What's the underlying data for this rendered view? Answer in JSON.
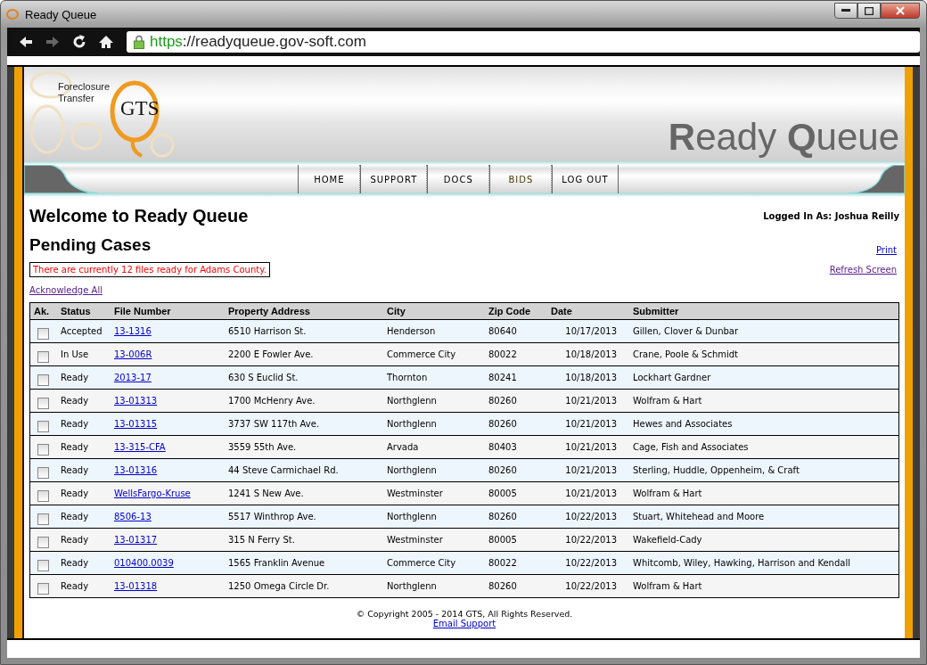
{
  "window": {
    "title": "Ready Queue"
  },
  "browser": {
    "url_scheme": "https",
    "url_rest": "://readyqueue.gov-soft.com"
  },
  "logo": {
    "line_1": "Foreclosure",
    "line_2": "Transfer",
    "mark": "GTS"
  },
  "site_title": "**R**eady **Q**ueue",
  "nav": [
    {
      "label": "HOME",
      "selected": false
    },
    {
      "label": "SUPPORT",
      "selected": false
    },
    {
      "label": "DOCS",
      "selected": false
    },
    {
      "label": "BIDS",
      "selected": true
    },
    {
      "label": "LOG OUT",
      "selected": false
    }
  ],
  "heading": "Welcome to Ready Queue",
  "logged_in": "Logged In As: Joshua Reilly",
  "subheading": "Pending Cases",
  "print_link": "Print",
  "notice": "There are currently 12 files ready for Adams County.",
  "refresh_link": "Refresh Screen",
  "acknowledge_link": "Acknowledge All",
  "table": {
    "columns": [
      "Ak.",
      "Status",
      "File Number",
      "Property Address",
      "City",
      "Zip Code",
      "Date",
      "Submitter"
    ],
    "rows": [
      {
        "checked": false,
        "status": "Accepted",
        "file": "13-1316",
        "address": "6510 Harrison St.",
        "city": "Henderson",
        "zip": "80640",
        "date": "10/17/2013",
        "submitter": "Gillen, Clover & Dunbar"
      },
      {
        "checked": false,
        "status": "In Use",
        "file": "13-006R",
        "address": "2200 E Fowler Ave.",
        "city": "Commerce City",
        "zip": "80022",
        "date": "10/18/2013",
        "submitter": "Crane, Poole & Schmidt"
      },
      {
        "checked": false,
        "status": "Ready",
        "file": "2013-17",
        "address": "630 S Euclid St.",
        "city": "Thornton",
        "zip": "80241",
        "date": "10/18/2013",
        "submitter": "Lockhart Gardner"
      },
      {
        "checked": false,
        "status": "Ready",
        "file": "13-01313",
        "address": "1700 McHenry Ave.",
        "city": "Northglenn",
        "zip": "80260",
        "date": "10/21/2013",
        "submitter": "Wolfram & Hart"
      },
      {
        "checked": false,
        "status": "Ready",
        "file": "13-01315",
        "address": "3737 SW 117th Ave.",
        "city": "Northglenn",
        "zip": "80260",
        "date": "10/21/2013",
        "submitter": "Hewes and Associates"
      },
      {
        "checked": false,
        "status": "Ready",
        "file": "13-315-CFA",
        "address": "3559 55th Ave.",
        "city": "Arvada",
        "zip": "80403",
        "date": "10/21/2013",
        "submitter": "Cage, Fish and Associates"
      },
      {
        "checked": false,
        "status": "Ready",
        "file": "13-01316",
        "address": "44 Steve Carmichael Rd.",
        "city": "Northglenn",
        "zip": "80260",
        "date": "10/21/2013",
        "submitter": "Sterling, Huddle, Oppenheim, & Craft"
      },
      {
        "checked": false,
        "status": "Ready",
        "file": "WellsFargo-Kruse",
        "address": "1241 S New Ave.",
        "city": "Westminster",
        "zip": "80005",
        "date": "10/21/2013",
        "submitter": "Wolfram & Hart"
      },
      {
        "checked": false,
        "status": "Ready",
        "file": "8506-13",
        "address": "5517 Winthrop Ave.",
        "city": "Northglenn",
        "zip": "80260",
        "date": "10/22/2013",
        "submitter": "Stuart, Whitehead and Moore"
      },
      {
        "checked": false,
        "status": "Ready",
        "file": "13-01317",
        "address": "315 N Ferry St.",
        "city": "Westminster",
        "zip": "80005",
        "date": "10/22/2013",
        "submitter": "Wakefield-Cady"
      },
      {
        "checked": false,
        "status": "Ready",
        "file": "010400.0039",
        "address": "1565 Franklin Avenue",
        "city": "Commerce City",
        "zip": "80022",
        "date": "10/22/2013",
        "submitter": "Whitcomb, Wiley, Hawking, Harrison and Kendall"
      },
      {
        "checked": false,
        "status": "Ready",
        "file": "13-01318",
        "address": "1250 Omega Circle Dr.",
        "city": "Northglenn",
        "zip": "80260",
        "date": "10/22/2013",
        "submitter": "Wolfram & Hart"
      }
    ]
  },
  "footer": {
    "copyright": "© Copyright 2005 - 2014 GTS, All Rights Reserved.",
    "email_link": "Email Support"
  }
}
